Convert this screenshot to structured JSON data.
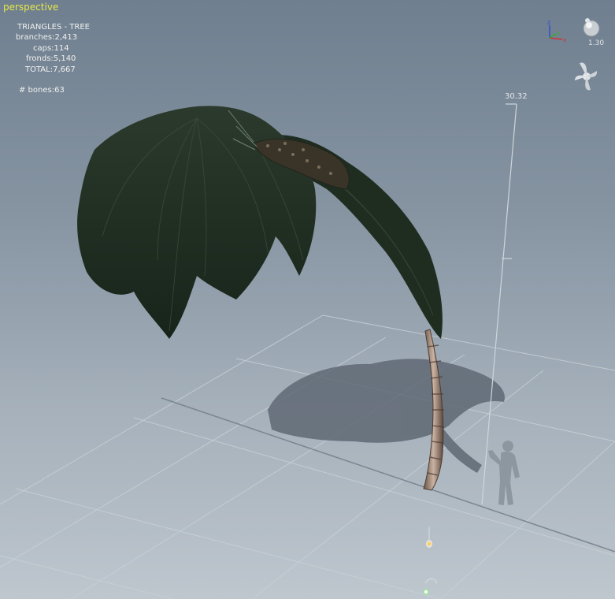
{
  "viewport": {
    "name": "perspective",
    "zoom": "1.30",
    "ruler_height": "30.32"
  },
  "stats": {
    "header": "TRIANGLES - TREE",
    "branches": "branches:2,413",
    "caps": "caps:114",
    "fronds": "fronds:5,140",
    "total": "TOTAL:7,667",
    "bones": "# bones:63"
  },
  "gizmo": {
    "axis_z": "z",
    "axis_y": "y",
    "axis_x": "x"
  },
  "colors": {
    "viewport_label": "#e6e64a",
    "axis_x": "#d03030",
    "axis_y": "#30b030",
    "axis_z": "#3050d0",
    "foliage": "#1f2e22",
    "trunk": "#8a7060"
  },
  "icons": [
    "axis-gizmo-icon",
    "zoom-sphere-icon",
    "camera-orbit-icon",
    "light-gizmo-icon",
    "wind-gizmo-icon"
  ]
}
